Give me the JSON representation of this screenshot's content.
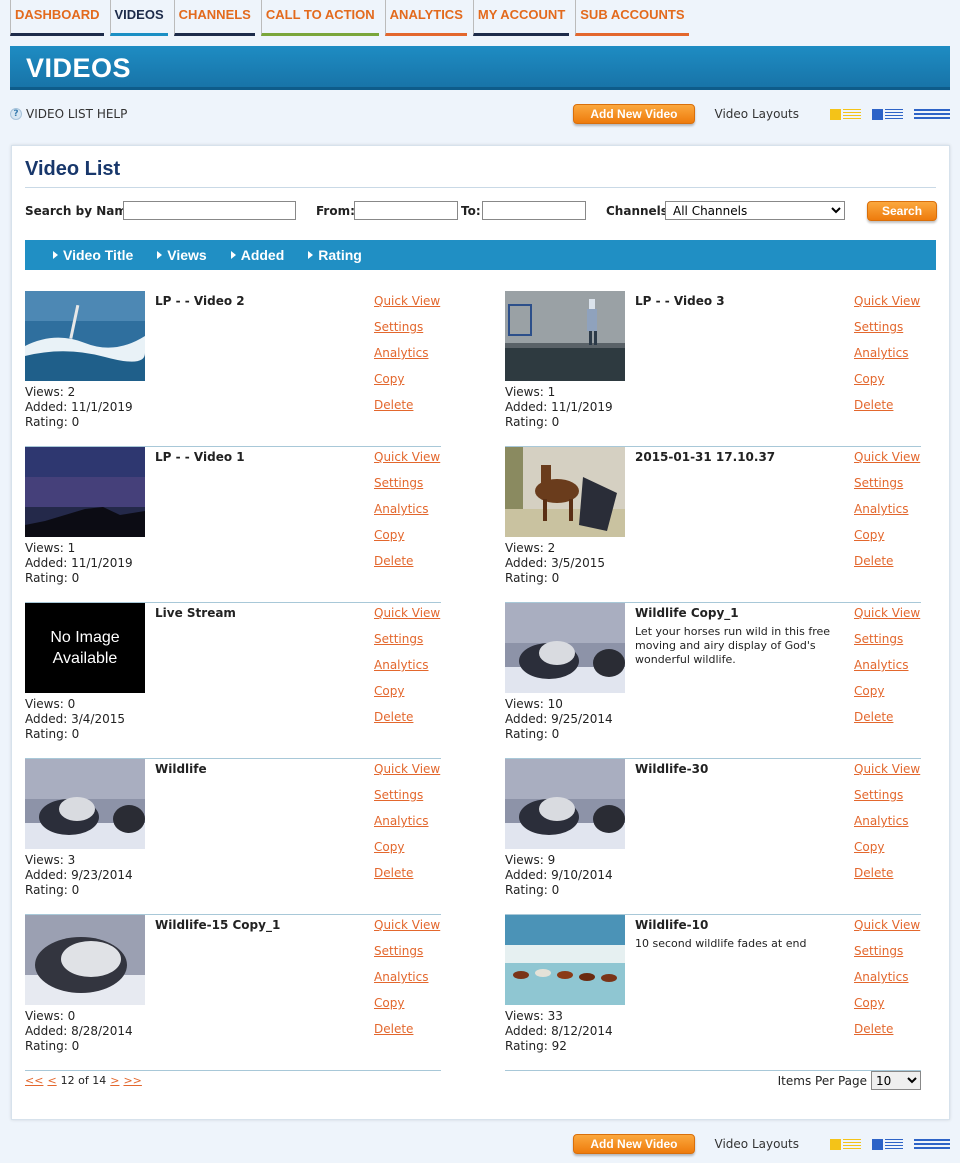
{
  "nav": {
    "tabs": [
      {
        "label": "DASHBOARD",
        "border": "#1d2b4a"
      },
      {
        "label": "VIDEOS",
        "border": "#1a8fc4"
      },
      {
        "label": "CHANNELS",
        "border": "#1d2b4a"
      },
      {
        "label": "CALL TO ACTION",
        "border": "#7aa63a"
      },
      {
        "label": "ANALYTICS",
        "border": "#e3672d"
      },
      {
        "label": "MY ACCOUNT",
        "border": "#1d2b4a"
      },
      {
        "label": "SUB ACCOUNTS",
        "border": "#e3672d"
      }
    ],
    "active": "VIDEOS"
  },
  "header": {
    "title": "VIDEOS"
  },
  "help": {
    "label": "VIDEO LIST HELP",
    "icon": "help-icon"
  },
  "toolbar": {
    "add_label": "Add New Video",
    "layouts_label": "Video Layouts"
  },
  "panel": {
    "title": "Video List"
  },
  "search": {
    "name_label": "Search by Name:",
    "name_value": "",
    "from_label": "From:",
    "from_value": "",
    "to_label": "To:",
    "to_value": "",
    "channels_label": "Channels:",
    "channels_selected": "All Channels",
    "button_label": "Search"
  },
  "columns": [
    "Video Title",
    "Views",
    "Added",
    "Rating"
  ],
  "labels": {
    "views": "Views:",
    "added": "Added:",
    "rating": "Rating:"
  },
  "actions": [
    "Quick View",
    "Settings",
    "Analytics",
    "Copy",
    "Delete"
  ],
  "videos": [
    {
      "title": "LP - - Video 2",
      "desc": "",
      "views": "2",
      "added": "11/1/2019",
      "rating": "0",
      "thumb": "surf"
    },
    {
      "title": "LP - - Video 3",
      "desc": "",
      "views": "1",
      "added": "11/1/2019",
      "rating": "0",
      "thumb": "pier"
    },
    {
      "title": "LP - - Video 1",
      "desc": "",
      "views": "1",
      "added": "11/1/2019",
      "rating": "0",
      "thumb": "night"
    },
    {
      "title": "2015-01-31 17.10.37",
      "desc": "",
      "views": "2",
      "added": "3/5/2015",
      "rating": "0",
      "thumb": "dog"
    },
    {
      "title": "Live Stream",
      "desc": "",
      "views": "0",
      "added": "3/4/2015",
      "rating": "0",
      "thumb": "none",
      "no_image_text": "No Image Available"
    },
    {
      "title": "Wildlife Copy_1",
      "desc": "Let your horses run wild in this free moving and airy display of God's wonderful wildlife.",
      "views": "10",
      "added": "9/25/2014",
      "rating": "0",
      "thumb": "seal"
    },
    {
      "title": "Wildlife",
      "desc": "",
      "views": "3",
      "added": "9/23/2014",
      "rating": "0",
      "thumb": "seal"
    },
    {
      "title": "Wildlife-30",
      "desc": "",
      "views": "9",
      "added": "9/10/2014",
      "rating": "0",
      "thumb": "seal"
    },
    {
      "title": "Wildlife-15 Copy_1",
      "desc": "",
      "views": "0",
      "added": "8/28/2014",
      "rating": "0",
      "thumb": "seal2"
    },
    {
      "title": "Wildlife-10",
      "desc": "10 second wildlife fades at end",
      "views": "33",
      "added": "8/12/2014",
      "rating": "92",
      "thumb": "horses"
    }
  ],
  "pagination": {
    "first": "<<",
    "prev": "<",
    "status": "12 of 14",
    "next": ">",
    "last": ">>"
  },
  "per_page": {
    "label": "Items Per Page",
    "selected": "10"
  },
  "colors": {
    "accent": "#208fc4",
    "link": "#e3672d",
    "button": "#ee7b0c"
  }
}
